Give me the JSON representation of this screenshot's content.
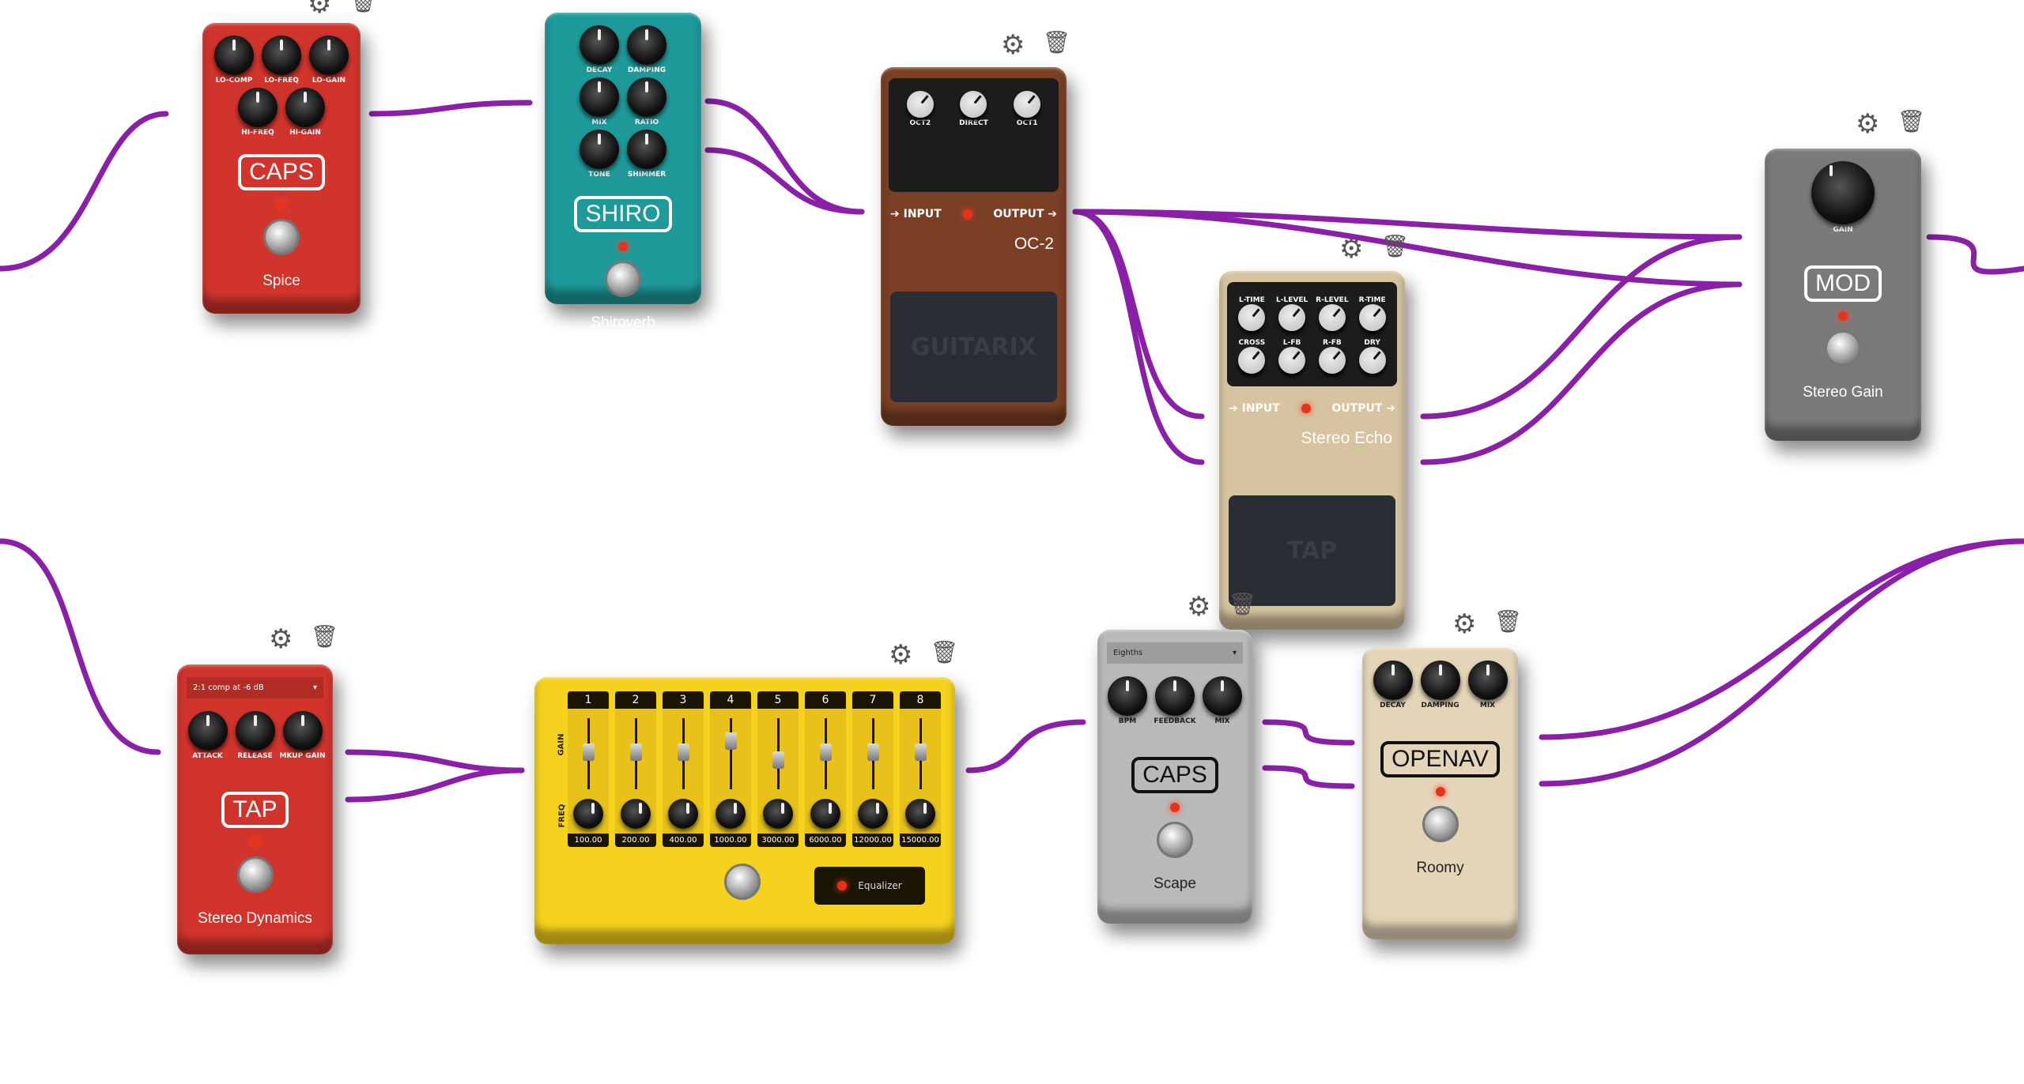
{
  "tool_icons": {
    "settings": "gear-icon",
    "delete": "trash-icon"
  },
  "cable_color": "#8a1fa8",
  "pedals": [
    {
      "id": "spice",
      "kind": "compact",
      "brand": "CAPS",
      "name": "Spice",
      "color": "#d0342c",
      "knobs": [
        "LO-COMP",
        "LO-FREQ",
        "LO-GAIN",
        "HI-FREQ",
        "HI-GAIN"
      ]
    },
    {
      "id": "shiroverb",
      "kind": "compact",
      "brand": "SHIRO",
      "name": "Shiroverb",
      "color": "#1f9a9a",
      "knobs": [
        "DECAY",
        "DAMPING",
        "MIX",
        "RATIO",
        "TONE",
        "SHIMMER"
      ]
    },
    {
      "id": "oc2",
      "kind": "boss",
      "name": "OC-2",
      "color": "#7a3f25",
      "knobs": [
        "OCT2",
        "DIRECT",
        "OCT1"
      ],
      "input_label": "INPUT",
      "output_label": "OUTPUT",
      "pad_text": "GUITARIX"
    },
    {
      "id": "echo",
      "kind": "boss",
      "name": "Stereo Echo",
      "color": "#d6c4a0",
      "knobs": [
        "L-TIME",
        "L-LEVEL",
        "R-LEVEL",
        "R-TIME",
        "CROSS",
        "L-FB",
        "R-FB",
        "DRY"
      ],
      "input_label": "INPUT",
      "output_label": "OUTPUT",
      "pad_text": "TAP"
    },
    {
      "id": "mod",
      "kind": "compact",
      "brand": "MOD",
      "name": "Stereo Gain",
      "color": "#7a7a7a",
      "knobs": [
        "GAIN"
      ]
    },
    {
      "id": "dyn",
      "kind": "compact",
      "brand": "TAP",
      "name": "Stereo Dynamics",
      "color": "#d0342c",
      "preset": "2:1 comp at -6 dB",
      "knobs": [
        "ATTACK",
        "RELEASE",
        "MKUP GAIN"
      ]
    },
    {
      "id": "eq",
      "kind": "eq",
      "name": "Equalizer",
      "color": "#f5d21e",
      "gain_label": "GAIN",
      "freq_label": "FREQ",
      "bands": [
        {
          "n": "1",
          "freq": "100.00",
          "gain": 0.55
        },
        {
          "n": "2",
          "freq": "200.00",
          "gain": 0.55
        },
        {
          "n": "3",
          "freq": "400.00",
          "gain": 0.55
        },
        {
          "n": "4",
          "freq": "1000.00",
          "gain": 0.75
        },
        {
          "n": "5",
          "freq": "3000.00",
          "gain": 0.4
        },
        {
          "n": "6",
          "freq": "6000.00",
          "gain": 0.55
        },
        {
          "n": "7",
          "freq": "12000.00",
          "gain": 0.55
        },
        {
          "n": "8",
          "freq": "15000.00",
          "gain": 0.55
        }
      ]
    },
    {
      "id": "scape",
      "kind": "compact",
      "brand": "CAPS",
      "name": "Scape",
      "color": "#b9b9b9",
      "dark": true,
      "preset": "Eighths",
      "knobs": [
        "BPM",
        "FEEDBACK",
        "MIX"
      ]
    },
    {
      "id": "roomy",
      "kind": "compact",
      "brand": "OPENAV",
      "name": "Roomy",
      "color": "#e5d5b8",
      "dark": true,
      "knobs": [
        "DECAY",
        "DAMPING",
        "MIX"
      ]
    }
  ]
}
